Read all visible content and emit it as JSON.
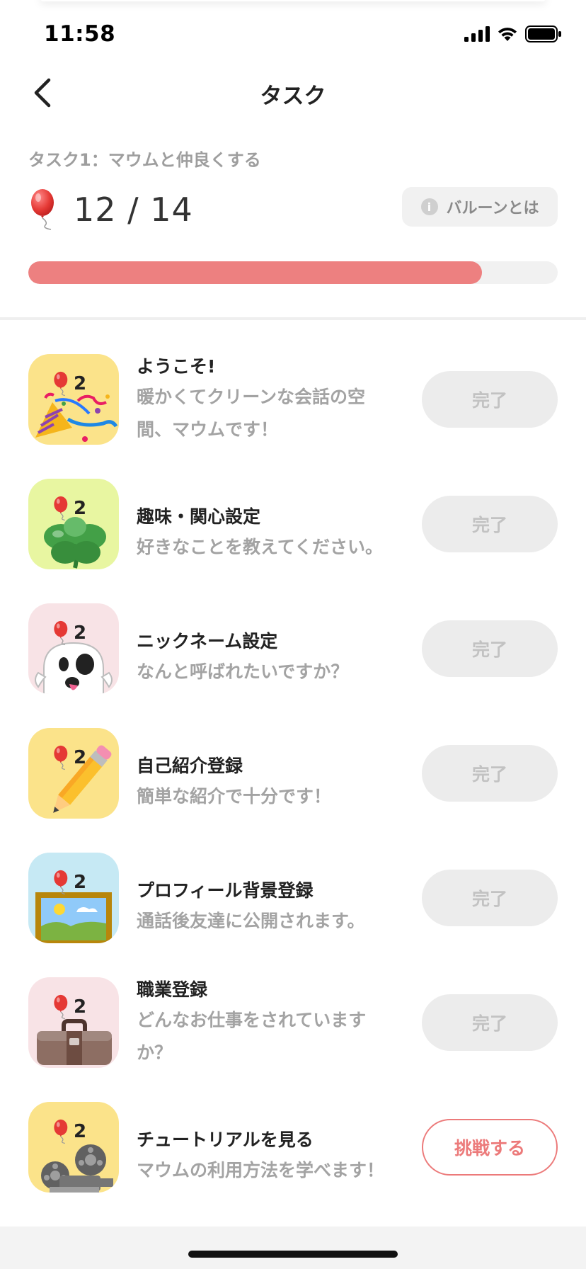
{
  "status_bar": {
    "time": "11:58",
    "icons": [
      "signal-icon",
      "wifi-icon",
      "battery-icon"
    ]
  },
  "nav": {
    "title": "タスク",
    "back_icon": "chevron-left-icon"
  },
  "task_header": {
    "subtitle": "タスク1：マウムと仲良くする",
    "balloon_count": "12 / 14",
    "progress": 0.857,
    "info_button_label": "バルーンとは"
  },
  "colors": {
    "accent": "#ed8080",
    "done_button_bg": "#ececec",
    "done_button_text": "#c2c2c2",
    "challenge_text": "#ec7a7a"
  },
  "tasks": [
    {
      "reward": "2",
      "title": "ようこそ!",
      "description": "暖かくてクリーンな会話の空間、マウムです！",
      "button": "完了",
      "icon": "party-popper-icon",
      "icon_bg": "#fbe38a",
      "status": "done"
    },
    {
      "reward": "2",
      "title": "趣味・関心設定",
      "description": "好きなことを教えてください。",
      "button": "完了",
      "icon": "four-leaf-clover-icon",
      "icon_bg": "#e8f6a1",
      "status": "done"
    },
    {
      "reward": "2",
      "title": "ニックネーム設定",
      "description": "なんと呼ばれたいですか？",
      "button": "完了",
      "icon": "ghost-icon",
      "icon_bg": "#f8e3e6",
      "status": "done"
    },
    {
      "reward": "2",
      "title": "自己紹介登録",
      "description": "簡単な紹介で十分です！",
      "button": "完了",
      "icon": "pencil-icon",
      "icon_bg": "#fbe38a",
      "status": "done"
    },
    {
      "reward": "2",
      "title": "プロフィール背景登録",
      "description": "通話後友達に公開されます。",
      "button": "完了",
      "icon": "framed-picture-icon",
      "icon_bg": "#c6e9f4",
      "status": "done"
    },
    {
      "reward": "2",
      "title": "職業登録",
      "description": "どんなお仕事をされていますか？",
      "button": "完了",
      "icon": "briefcase-icon",
      "icon_bg": "#f8e3e6",
      "status": "done"
    },
    {
      "reward": "2",
      "title": "チュートリアルを見る",
      "description": "マウムの利用方法を学べます！",
      "button": "挑戦する",
      "icon": "film-projector-icon",
      "icon_bg": "#fbe38a",
      "status": "todo"
    }
  ]
}
